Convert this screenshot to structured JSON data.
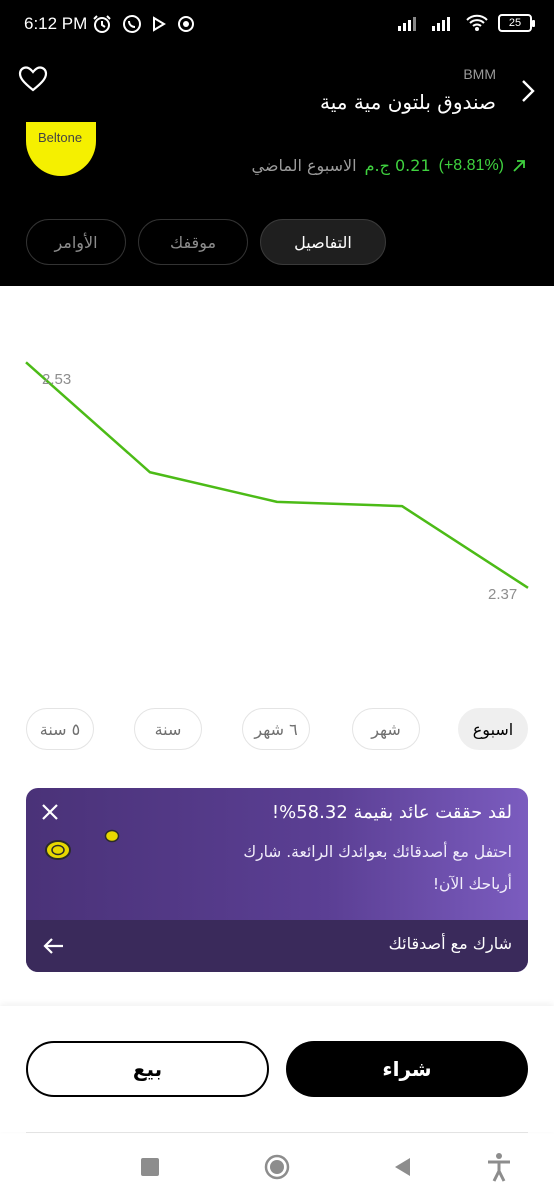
{
  "status_bar": {
    "time": "6:12 PM",
    "battery": "25",
    "left_icons": [
      "alarm-icon",
      "whatsapp-icon",
      "play-icon",
      "record-icon"
    ],
    "right_icons": [
      "signal-icon",
      "signal-icon",
      "wifi-icon",
      "battery-icon"
    ]
  },
  "header": {
    "ticker": "BMM",
    "fund_name": "صندوق بلتون مية مية",
    "logo_text": "Beltone",
    "change_pct": "(+8.81%)",
    "change_amount": "0.21 ج.م",
    "change_period": "الاسبوع الماضي",
    "positive_color": "#3fd23f"
  },
  "tabs": [
    {
      "label": "التفاصيل",
      "active": true
    },
    {
      "label": "موقفك",
      "active": false
    },
    {
      "label": "الأوامر",
      "active": false
    }
  ],
  "chart_data": {
    "type": "line",
    "x": [
      "1",
      "2",
      "3",
      "4",
      "5"
    ],
    "series": [
      {
        "values": [
          2.53,
          2.452,
          2.431,
          2.428,
          2.37
        ]
      }
    ],
    "labels": {
      "max": "2.53",
      "min": "2.37"
    },
    "ylim": [
      2.35,
      2.57
    ],
    "color": "#4cbb17",
    "grid": false
  },
  "periods": [
    {
      "label": "اسبوع",
      "active": true
    },
    {
      "label": "شهر",
      "active": false
    },
    {
      "label": "٦ شهر",
      "active": false
    },
    {
      "label": "سنة",
      "active": false
    },
    {
      "label": "٥ سنة",
      "active": false
    }
  ],
  "promo": {
    "title": "لقد حققت عائد بقيمة 58.32%!",
    "body": "احتفل مع أصدقائك بعوائدك الرائعة. شارك أرباحك الآن!",
    "share_label": "شارك مع أصدقائك"
  },
  "actions": {
    "buy": "شراء",
    "sell": "بيع"
  }
}
